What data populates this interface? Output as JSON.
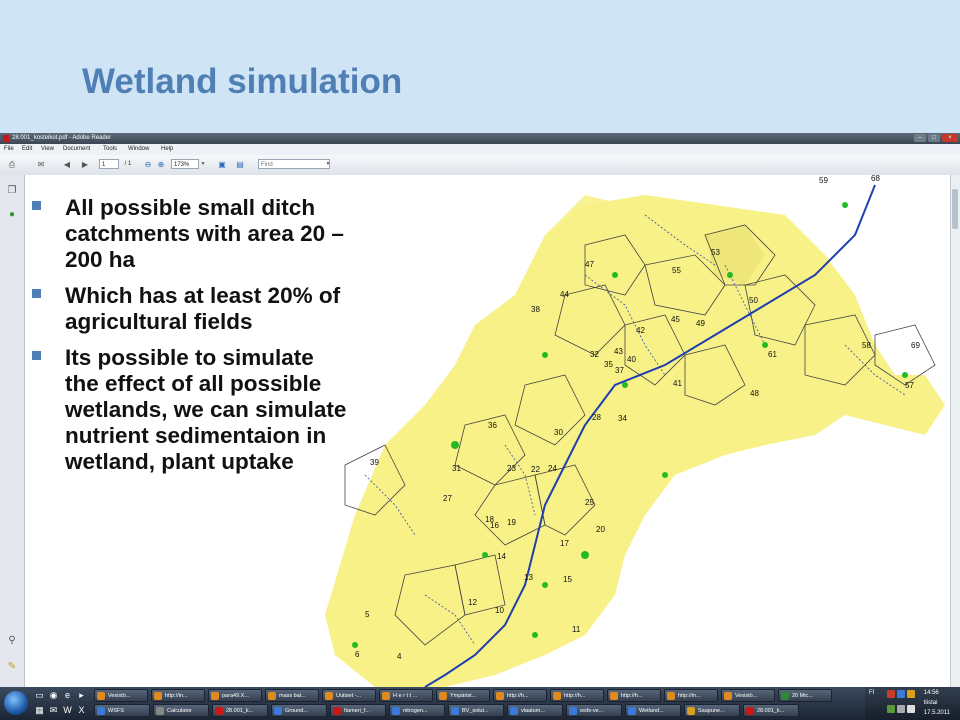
{
  "slide": {
    "title": "Wetland simulation",
    "bullets": [
      "All possible small ditch catchments with area 20 – 200 ha",
      "Which has at least 20% of agricultural fields",
      "Its possible to simulate the effect of all possible wetlands, we can simulate nutrient sedimentaion in wetland, plant uptake"
    ],
    "accent_color": "#4f7fb5"
  },
  "reader": {
    "window_title": "28.001_kosteikot.pdf - Adobe Reader",
    "menu": [
      "File",
      "Edit",
      "View",
      "Document",
      "Tools",
      "Window",
      "Help"
    ],
    "page_current": "1",
    "page_total": "/ 1",
    "zoom": "173%",
    "find_placeholder": "Find"
  },
  "map": {
    "catchment_labels": [
      "59",
      "68",
      "53",
      "47",
      "55",
      "44",
      "50",
      "38",
      "45",
      "49",
      "42",
      "43",
      "32",
      "40",
      "35",
      "37",
      "41",
      "61",
      "58",
      "69",
      "57",
      "48",
      "28",
      "34",
      "36",
      "30",
      "23",
      "22",
      "24",
      "31",
      "27",
      "25",
      "18",
      "16",
      "19",
      "20",
      "17",
      "14",
      "13",
      "15",
      "12",
      "10",
      "11",
      "5",
      "6",
      "4",
      "39"
    ],
    "water_color": "#1f3fb0",
    "field_color": "#f7f187",
    "wetland_color": "#22bb22"
  },
  "taskbar": {
    "row1": [
      "Vesistö...",
      "http://in...",
      "para49.X...",
      "mass bal...",
      "Uutiset -...",
      "H e r t t ...",
      "Ympärist...",
      "http://h...",
      "http://h...",
      "http://h...",
      "http://in...",
      "Vesistö...",
      "20 Mic..."
    ],
    "row2": [
      "WSFS",
      "Calculator",
      "28.001_k...",
      "Ground...",
      "Itameri_f...",
      "nitrogen...",
      "BV_solut...",
      "vlaatum...",
      "wsfs-ve...",
      "Wetland...",
      "Saapune...",
      "28.001_k..."
    ],
    "lang": "FI",
    "time": "14:56",
    "day": "tiistai",
    "date": "17.5.2011"
  }
}
